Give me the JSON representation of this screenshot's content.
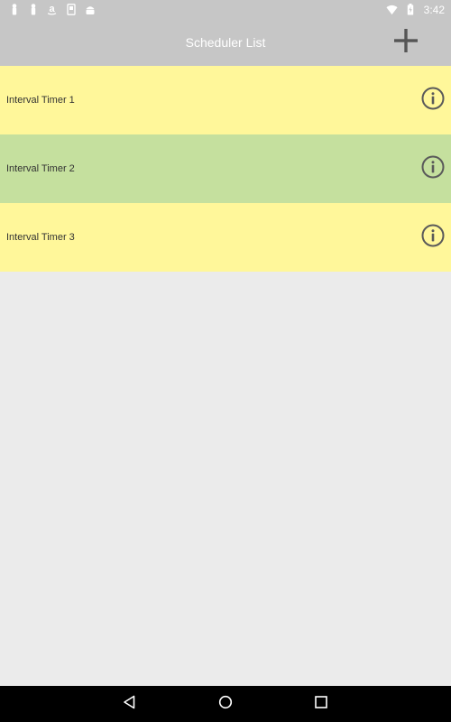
{
  "status_bar": {
    "time": "3:42",
    "left_icons": [
      "notification-icon",
      "notification-icon",
      "amazon-icon",
      "sd-card-icon",
      "android-icon"
    ],
    "right_icons": [
      "wifi-icon",
      "battery-icon"
    ]
  },
  "app_bar": {
    "title": "Scheduler List",
    "action_icon": "add-icon",
    "color": "#c6c6c6"
  },
  "list": {
    "items": [
      {
        "label": "Interval Timer 1",
        "color": "#fff79a",
        "icon": "info-icon"
      },
      {
        "label": "Interval Timer 2",
        "color": "#c5e09e",
        "icon": "info-icon"
      },
      {
        "label": "Interval Timer 3",
        "color": "#fff79a",
        "icon": "info-icon"
      }
    ]
  },
  "nav_bar": {
    "buttons": [
      "back-icon",
      "home-icon",
      "recents-icon"
    ]
  },
  "colors": {
    "background": "#ebebeb",
    "icon_gray": "#5a5a5a",
    "nav_bar": "#000000"
  }
}
